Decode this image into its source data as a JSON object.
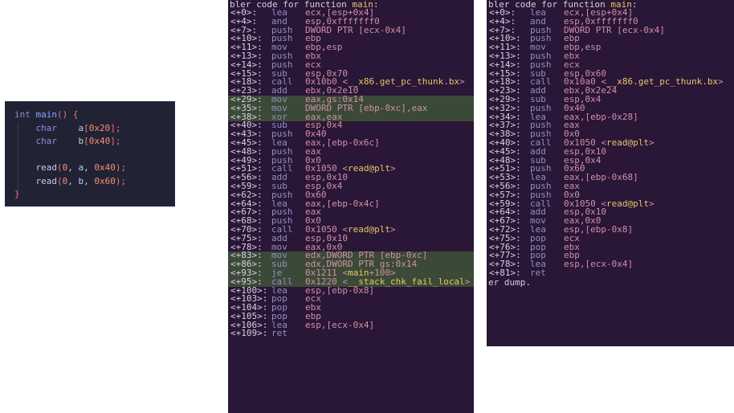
{
  "source_code": {
    "lines": [
      [
        {
          "t": "int ",
          "c": "kw"
        },
        {
          "t": "main",
          "c": "fn"
        },
        {
          "t": "() {",
          "c": "br"
        }
      ],
      [
        {
          "t": "    char",
          "c": "kw"
        },
        {
          "t": "    a",
          "c": "var"
        },
        {
          "t": "[",
          "c": "br"
        },
        {
          "t": "0x20",
          "c": "num"
        },
        {
          "t": "];",
          "c": "br"
        }
      ],
      [
        {
          "t": "    char",
          "c": "kw"
        },
        {
          "t": "    b",
          "c": "var"
        },
        {
          "t": "[",
          "c": "br"
        },
        {
          "t": "0x40",
          "c": "num"
        },
        {
          "t": "];",
          "c": "br"
        }
      ],
      [
        {
          "t": "",
          "c": "var"
        }
      ],
      [
        {
          "t": "    read",
          "c": "var"
        },
        {
          "t": "(",
          "c": "br"
        },
        {
          "t": "0",
          "c": "num"
        },
        {
          "t": ", a, ",
          "c": "var"
        },
        {
          "t": "0x40",
          "c": "num"
        },
        {
          "t": ");",
          "c": "br"
        }
      ],
      [
        {
          "t": "    read",
          "c": "var"
        },
        {
          "t": "(",
          "c": "br"
        },
        {
          "t": "0",
          "c": "num"
        },
        {
          "t": ", b, ",
          "c": "var"
        },
        {
          "t": "0x60",
          "c": "num"
        },
        {
          "t": ");",
          "c": "br"
        }
      ],
      [
        {
          "t": "}",
          "c": "br"
        }
      ]
    ]
  },
  "disasm_left": {
    "header": "bler code for function ",
    "func": "main",
    "header_tail": ":",
    "rows": [
      {
        "off": "<+0>:",
        "mn": "lea",
        "ops": "ecx,[esp+0x4]"
      },
      {
        "off": "<+4>:",
        "mn": "and",
        "ops": "esp,0xfffffff0"
      },
      {
        "off": "<+7>:",
        "mn": "push",
        "ops": "DWORD PTR [ecx-0x4]"
      },
      {
        "off": "<+10>:",
        "mn": "push",
        "ops": "ebp"
      },
      {
        "off": "<+11>:",
        "mn": "mov",
        "ops": "ebp,esp"
      },
      {
        "off": "<+13>:",
        "mn": "push",
        "ops": "ebx"
      },
      {
        "off": "<+14>:",
        "mn": "push",
        "ops": "ecx"
      },
      {
        "off": "<+15>:",
        "mn": "sub",
        "ops": "esp,0x70"
      },
      {
        "off": "<+18>:",
        "mn": "call",
        "ops": "0x10b0 <__x86.get_pc_thunk.bx>"
      },
      {
        "off": "<+23>:",
        "mn": "add",
        "ops": "ebx,0x2e10"
      },
      {
        "off": "<+29>:",
        "mn": "mov",
        "ops": "eax,gs:0x14",
        "hl": true
      },
      {
        "off": "<+35>:",
        "mn": "mov",
        "ops": "DWORD PTR [ebp-0xc],eax",
        "hl": true
      },
      {
        "off": "<+38>:",
        "mn": "xor",
        "ops": "eax,eax",
        "hl": true
      },
      {
        "off": "<+40>:",
        "mn": "sub",
        "ops": "esp,0x4"
      },
      {
        "off": "<+43>:",
        "mn": "push",
        "ops": "0x40"
      },
      {
        "off": "<+45>:",
        "mn": "lea",
        "ops": "eax,[ebp-0x6c]"
      },
      {
        "off": "<+48>:",
        "mn": "push",
        "ops": "eax"
      },
      {
        "off": "<+49>:",
        "mn": "push",
        "ops": "0x0"
      },
      {
        "off": "<+51>:",
        "mn": "call",
        "ops": "0x1050 <read@plt>"
      },
      {
        "off": "<+56>:",
        "mn": "add",
        "ops": "esp,0x10"
      },
      {
        "off": "<+59>:",
        "mn": "sub",
        "ops": "esp,0x4"
      },
      {
        "off": "<+62>:",
        "mn": "push",
        "ops": "0x60"
      },
      {
        "off": "<+64>:",
        "mn": "lea",
        "ops": "eax,[ebp-0x4c]"
      },
      {
        "off": "<+67>:",
        "mn": "push",
        "ops": "eax"
      },
      {
        "off": "<+68>:",
        "mn": "push",
        "ops": "0x0"
      },
      {
        "off": "<+70>:",
        "mn": "call",
        "ops": "0x1050 <read@plt>"
      },
      {
        "off": "<+75>:",
        "mn": "add",
        "ops": "esp,0x10"
      },
      {
        "off": "<+78>:",
        "mn": "mov",
        "ops": "eax,0x0"
      },
      {
        "off": "<+83>:",
        "mn": "mov",
        "ops": "edx,DWORD PTR [ebp-0xc]",
        "hl": true
      },
      {
        "off": "<+86>:",
        "mn": "sub",
        "ops": "edx,DWORD PTR gs:0x14",
        "hl": true
      },
      {
        "off": "<+93>:",
        "mn": "je",
        "ops": "0x1211 <main+100>",
        "hl": true
      },
      {
        "off": "<+95>:",
        "mn": "call",
        "ops": "0x1220 <__stack_chk_fail_local>",
        "hl": true
      },
      {
        "off": "<+100>:",
        "mn": "lea",
        "ops": "esp,[ebp-0x8]"
      },
      {
        "off": "<+103>:",
        "mn": "pop",
        "ops": "ecx"
      },
      {
        "off": "<+104>:",
        "mn": "pop",
        "ops": "ebx"
      },
      {
        "off": "<+105>:",
        "mn": "pop",
        "ops": "ebp"
      },
      {
        "off": "<+106>:",
        "mn": "lea",
        "ops": "esp,[ecx-0x4]"
      },
      {
        "off": "<+109>:",
        "mn": "ret",
        "ops": ""
      }
    ]
  },
  "disasm_right": {
    "header": "bler code for function ",
    "func": "main",
    "header_tail": ":",
    "footer": "er dump.",
    "rows": [
      {
        "off": "<+0>:",
        "mn": "lea",
        "ops": "ecx,[esp+0x4]"
      },
      {
        "off": "<+4>:",
        "mn": "and",
        "ops": "esp,0xfffffff0"
      },
      {
        "off": "<+7>:",
        "mn": "push",
        "ops": "DWORD PTR [ecx-0x4]"
      },
      {
        "off": "<+10>:",
        "mn": "push",
        "ops": "ebp"
      },
      {
        "off": "<+11>:",
        "mn": "mov",
        "ops": "ebp,esp"
      },
      {
        "off": "<+13>:",
        "mn": "push",
        "ops": "ebx"
      },
      {
        "off": "<+14>:",
        "mn": "push",
        "ops": "ecx"
      },
      {
        "off": "<+15>:",
        "mn": "sub",
        "ops": "esp,0x60"
      },
      {
        "off": "<+18>:",
        "mn": "call",
        "ops": "0x10a0 <__x86.get_pc_thunk.bx>"
      },
      {
        "off": "<+23>:",
        "mn": "add",
        "ops": "ebx,0x2e24"
      },
      {
        "off": "<+29>:",
        "mn": "sub",
        "ops": "esp,0x4"
      },
      {
        "off": "<+32>:",
        "mn": "push",
        "ops": "0x40"
      },
      {
        "off": "<+34>:",
        "mn": "lea",
        "ops": "eax,[ebp-0x28]"
      },
      {
        "off": "<+37>:",
        "mn": "push",
        "ops": "eax"
      },
      {
        "off": "<+38>:",
        "mn": "push",
        "ops": "0x0"
      },
      {
        "off": "<+40>:",
        "mn": "call",
        "ops": "0x1050 <read@plt>"
      },
      {
        "off": "<+45>:",
        "mn": "add",
        "ops": "esp,0x10"
      },
      {
        "off": "<+48>:",
        "mn": "sub",
        "ops": "esp,0x4"
      },
      {
        "off": "<+51>:",
        "mn": "push",
        "ops": "0x60"
      },
      {
        "off": "<+53>:",
        "mn": "lea",
        "ops": "eax,[ebp-0x68]"
      },
      {
        "off": "<+56>:",
        "mn": "push",
        "ops": "eax"
      },
      {
        "off": "<+57>:",
        "mn": "push",
        "ops": "0x0"
      },
      {
        "off": "<+59>:",
        "mn": "call",
        "ops": "0x1050 <read@plt>"
      },
      {
        "off": "<+64>:",
        "mn": "add",
        "ops": "esp,0x10"
      },
      {
        "off": "<+67>:",
        "mn": "mov",
        "ops": "eax,0x0"
      },
      {
        "off": "<+72>:",
        "mn": "lea",
        "ops": "esp,[ebp-0x8]"
      },
      {
        "off": "<+75>:",
        "mn": "pop",
        "ops": "ecx"
      },
      {
        "off": "<+76>:",
        "mn": "pop",
        "ops": "ebx"
      },
      {
        "off": "<+77>:",
        "mn": "pop",
        "ops": "ebp"
      },
      {
        "off": "<+78>:",
        "mn": "lea",
        "ops": "esp,[ecx-0x4]"
      },
      {
        "off": "<+81>:",
        "mn": "ret",
        "ops": ""
      }
    ]
  },
  "colors": {
    "editor_bg": "#212335",
    "terminal_bg": "#2a1636",
    "highlight_bg": "#3b4a37",
    "function_name": "#e7c66a"
  }
}
